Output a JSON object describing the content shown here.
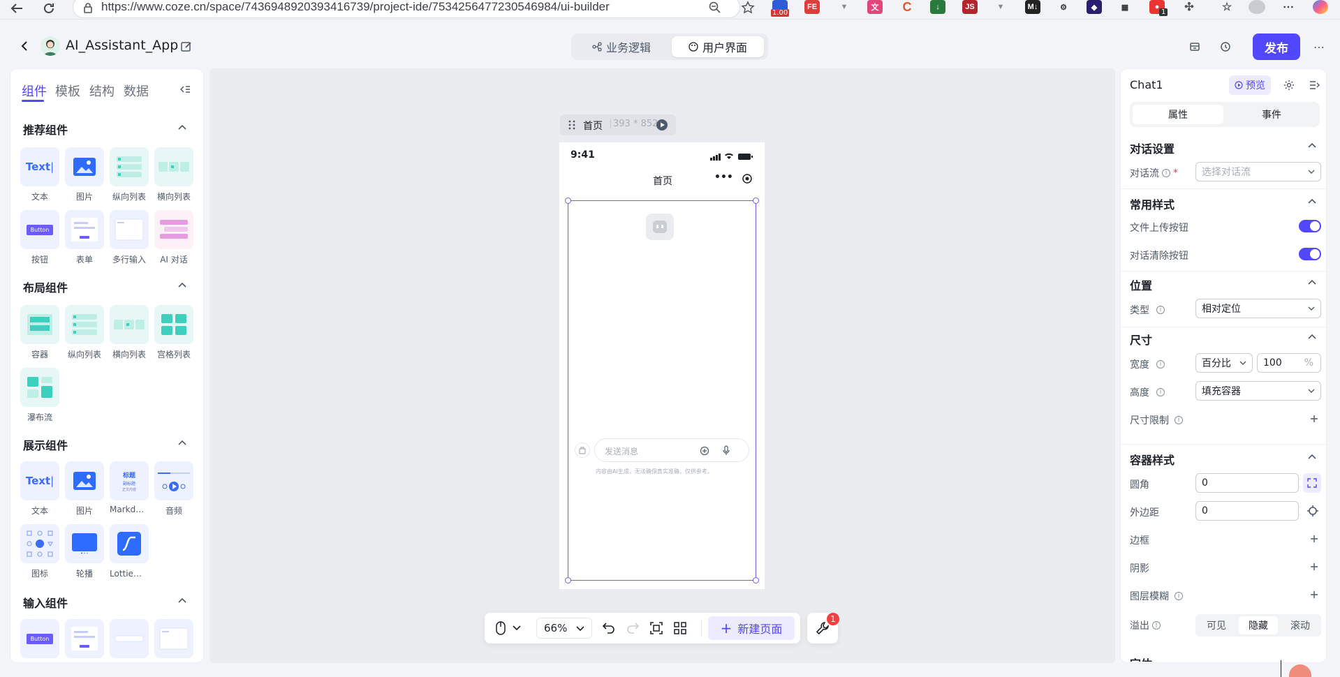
{
  "browser": {
    "url": "https://www.coze.cn/space/7436948920393416739/project-ide/7534256477230546984/ui-builder",
    "ext_badge": "1.00",
    "ext_count": "1"
  },
  "header": {
    "app_name": "AI_Assistant_App",
    "tab_logic": "业务逻辑",
    "tab_ui": "用户界面",
    "publish": "发布"
  },
  "left": {
    "tabs": [
      "组件",
      "模板",
      "结构",
      "数据"
    ],
    "sections": [
      {
        "title": "推荐组件",
        "items": [
          "文本",
          "图片",
          "纵向列表",
          "横向列表",
          "按钮",
          "表单",
          "多行输入",
          "AI 对话"
        ]
      },
      {
        "title": "布局组件",
        "items": [
          "容器",
          "纵向列表",
          "横向列表",
          "宫格列表",
          "瀑布流"
        ]
      },
      {
        "title": "展示组件",
        "items": [
          "文本",
          "图片",
          "Markdo…",
          "音频",
          "图标",
          "轮播",
          "Lottie动画"
        ]
      },
      {
        "title": "输入组件",
        "items": []
      }
    ],
    "thumb_text": "Text",
    "thumb_button": "Button",
    "thumb_md": [
      "标题",
      "副标题",
      "正文内容"
    ]
  },
  "canvas": {
    "page_name": "首页",
    "page_size": "393 * 852",
    "phone_time": "9:41",
    "phone_title": "首页",
    "chat_placeholder": "发送消息",
    "chat_disclaimer": "内容由AI生成，无法确保真实准确，仅供参考。",
    "zoom": "66%",
    "new_page": "新建页面",
    "tool_badge": "1"
  },
  "right": {
    "component": "Chat1",
    "preview": "预览",
    "tab_props": "属性",
    "tab_events": "事件",
    "s_dialog": "对话设置",
    "dialog_flow_label": "对话流",
    "dialog_flow_placeholder": "选择对话流",
    "s_style": "常用样式",
    "upload_btn_label": "文件上传按钮",
    "clear_btn_label": "对话清除按钮",
    "s_position": "位置",
    "type_label": "类型",
    "type_value": "相对定位",
    "s_size": "尺寸",
    "width_label": "宽度",
    "width_unit": "百分比",
    "width_value": "100",
    "width_suffix": "%",
    "height_label": "高度",
    "height_value": "填充容器",
    "size_limit_label": "尺寸限制",
    "s_container": "容器样式",
    "radius_label": "圆角",
    "radius_value": "0",
    "margin_label": "外边距",
    "margin_value": "0",
    "border_label": "边框",
    "shadow_label": "阴影",
    "blur_label": "图层模糊",
    "overflow_label": "溢出",
    "overflow_options": [
      "可见",
      "隐藏",
      "滚动"
    ],
    "cut_section": "字体"
  },
  "colors": {
    "accent": "#5147ff",
    "teal": "#3ecfbe",
    "danger": "#f53f3f"
  }
}
